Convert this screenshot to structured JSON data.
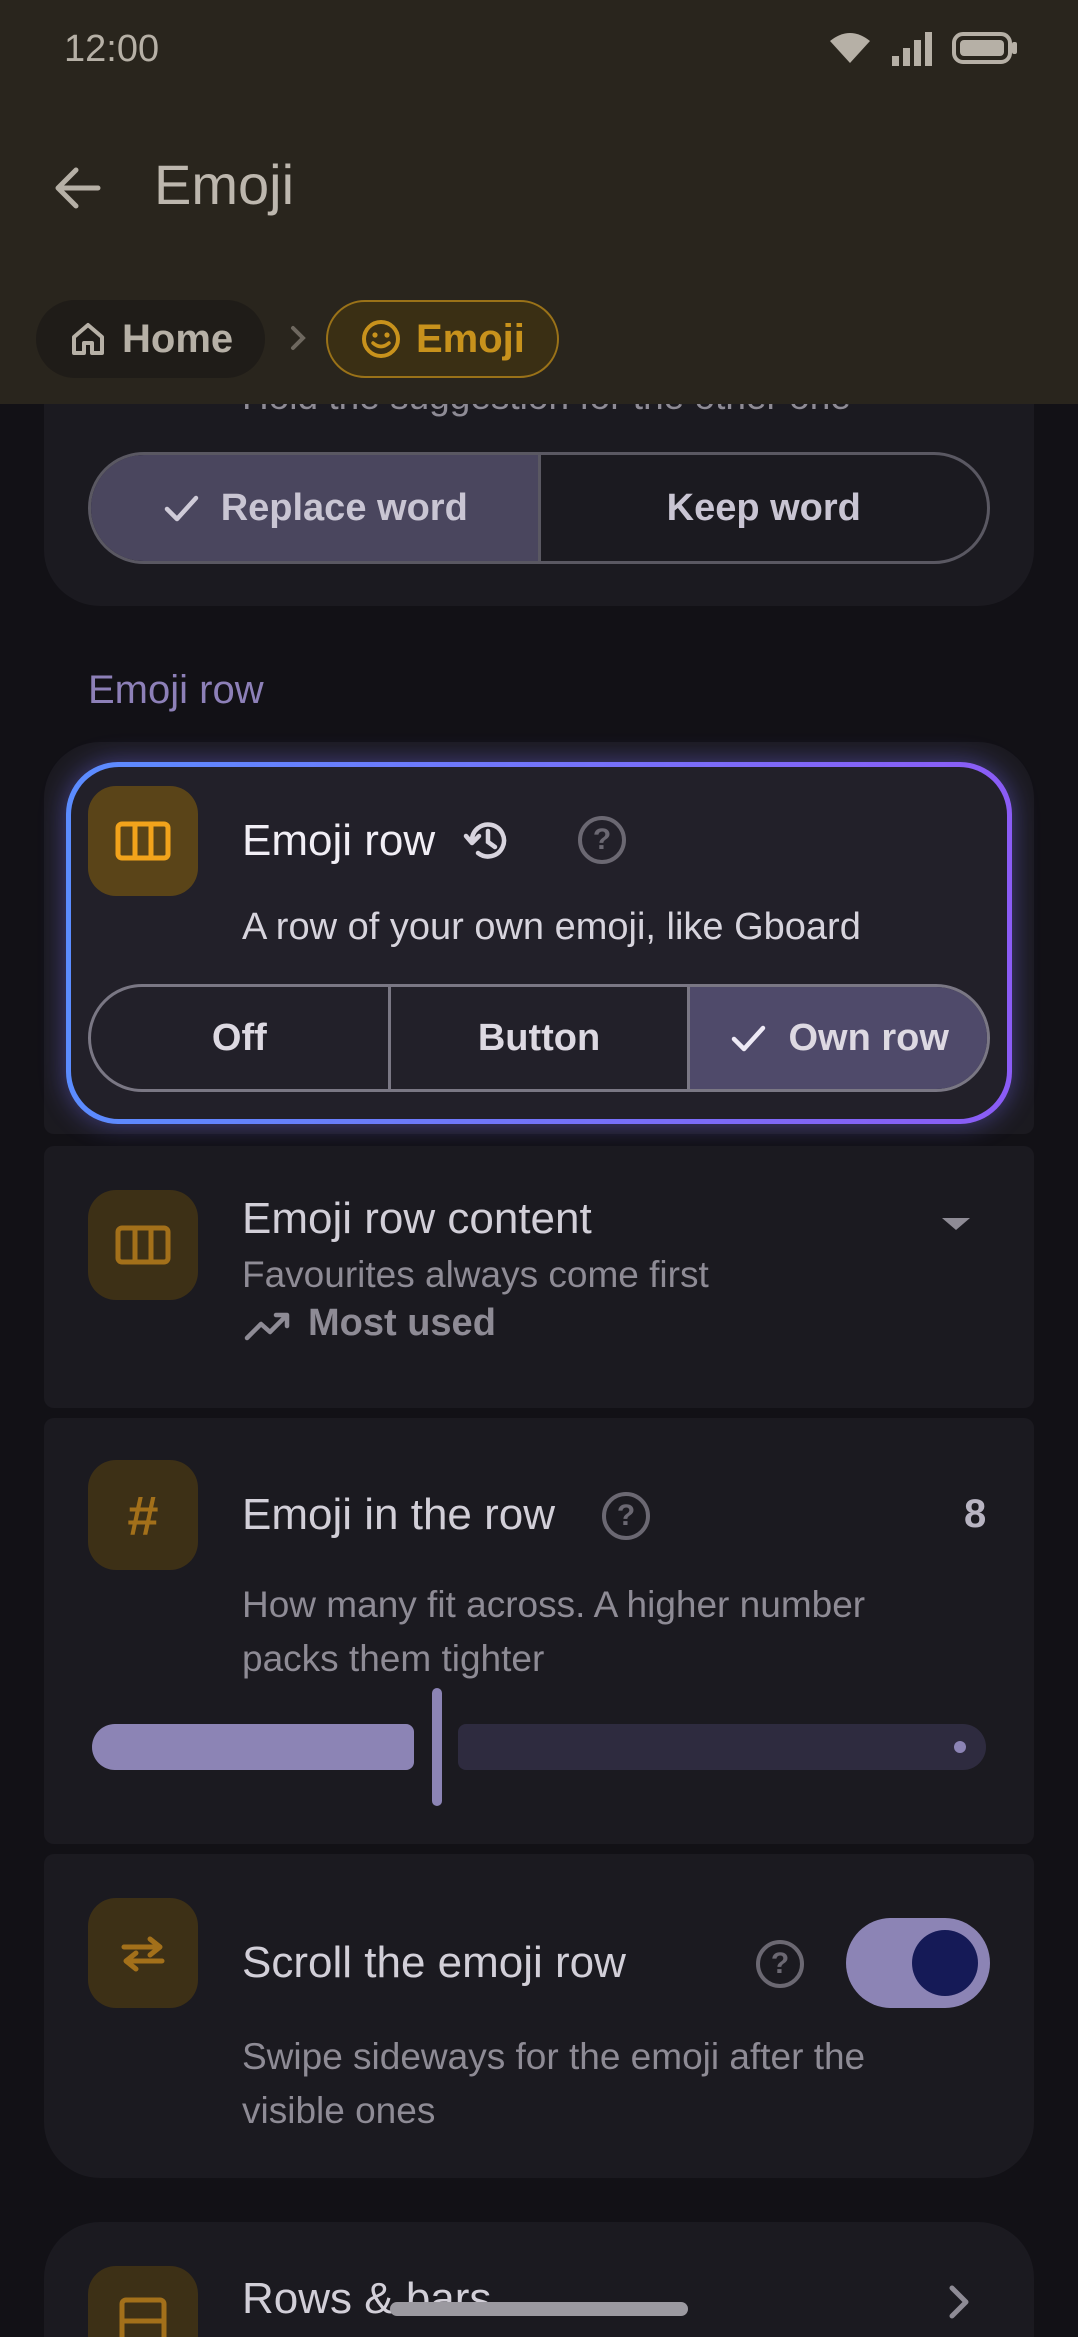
{
  "status": {
    "time": "12:00"
  },
  "header": {
    "title": "Emoji"
  },
  "breadcrumb": {
    "home": "Home",
    "current": "Emoji"
  },
  "top_card": {
    "partial_text": "Hold the suggestion for the other one",
    "options": [
      "Replace word",
      "Keep word"
    ],
    "selected": "Replace word"
  },
  "section": {
    "title": "Emoji row"
  },
  "emoji_row": {
    "title": "Emoji row",
    "desc": "A row of your own emoji, like Gboard",
    "options": [
      "Off",
      "Button",
      "Own row"
    ],
    "selected": "Own row"
  },
  "row_content": {
    "title": "Emoji row content",
    "desc": "Favourites always come first",
    "value": "Most used"
  },
  "emoji_count": {
    "title": "Emoji in the row",
    "value": "8",
    "desc_line1": "How many fit across. A higher number",
    "desc_line2": "packs them tighter",
    "slider_fraction": 0.38
  },
  "scroll_row": {
    "title": "Scroll the emoji row",
    "desc_line1": "Swipe sideways for the emoji after the",
    "desc_line2": "visible ones",
    "enabled": true
  },
  "rows_bars": {
    "title": "Rows & bars"
  },
  "colors": {
    "accent_amber": "#f2a31b",
    "accent_purple": "#9a8fc4",
    "highlight_border_start": "#5b8cff",
    "highlight_border_end": "#8b5cf6"
  }
}
